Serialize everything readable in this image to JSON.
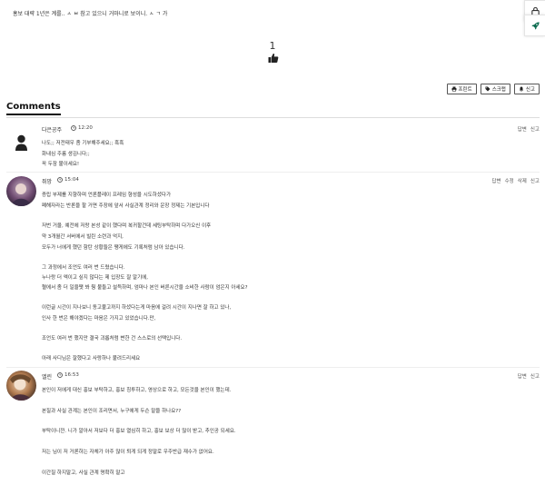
{
  "post": {
    "text": "홍보 대략 1년은 계를.. ㅅ ㅂ   참고 있으니 거마니로 보이니.   ㅅ ㄱ 가"
  },
  "side": {
    "icons": [
      "lock-icon",
      "rocket-icon"
    ]
  },
  "likes": {
    "count": "1"
  },
  "actions": {
    "print": "프린트",
    "scrap": "스크랩",
    "report": "신고"
  },
  "comments_title": "Comments",
  "comments": [
    {
      "author": "다은공주",
      "time": "12:20",
      "actions": [
        "답변",
        "신고"
      ],
      "lines": [
        "나도;;  저전태우 좀 기부해주세요;; 흑흑",
        "화내심 주름 생김니다;;",
        "꼭 두잠 불이세요!"
      ]
    },
    {
      "author": "쥐망",
      "time": "15:04",
      "actions": [
        "답변",
        "수정",
        "삭제",
        "신고"
      ],
      "lines": [
        "증립 부제를 지향하며 언론플레이 프레임 형성을 시도하셨다가",
        "폐해자라는 반론을 할 거면 주장에 앞서 사실관계 정리와 운장 정제는 기본입니다",
        "저번 거울, 예전에 저랑 본성 같이 했다며 복귀할건데 세팅부탁하며 다가오신 이후",
        "약 3개월간 서버에서 빌린 소련과 억지,",
        "모두가 너에게 했던 함탄 상황들은 쨍게에도 기록처럼 남아 있습니다.",
        "그 과정에서 조언도 여러 번 드렸습니다.",
        "누나랑 더 엑이고 싶지 않다는 제 입장도 잘 알기에,",
        "혈에서 좀 더 일을쨋 봐 줭 불들고 설득하며, 엄마나 본인 버른시간을 소비한 사람이 엄은지 아세요?",
        "이런글 시간이 지나보니 동고불고까지 하셨다는게 마음에 걸려 시간이 지나면 잘 하고 있나,",
        "인사 한 번은 해야겠다는 마음은 가지고 있었습니다.만,",
        "조언도 여러 번 했지만 결국 괴롭처럼 변한 건 스스로의 선택입니다.",
        "아래 사디님은 잘했다고 사랑하나 붙려드리세요"
      ]
    },
    {
      "author": "엘린",
      "time": "16:53",
      "actions": [
        "답변",
        "신고"
      ],
      "lines": [
        "본인이  저에게 대신 홍보 부탁하고, 홍보 칭투하고, 영상으로 하고, 모든것을 본인이  했는데.",
        "본질과 사실 관계는 본인이  조리면서, 누구에게 두슨 말을 하나요??",
        " 부탁이니깐. 니가 알아서 저보다 더 홍보 열심히 하고, 홍보 보상 더 많이 받고, 추인공 되세요.",
        "저는 님이 저 거론하는 자체가  아주 많이 퇴게 되게 정말로 우주반급 재수가  없어요.",
        "이간질 하지말고, 사실 관계 명확히 말고"
      ]
    }
  ]
}
